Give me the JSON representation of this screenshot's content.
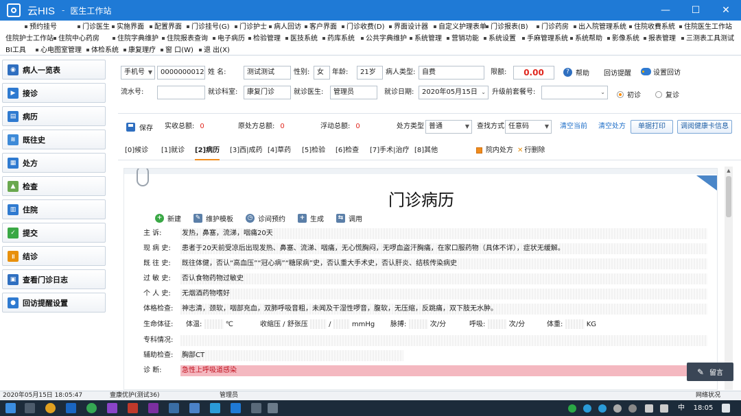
{
  "window": {
    "app_name": "云HIS",
    "subtitle": "医生工作站",
    "controls": [
      "—",
      "☐",
      "✕"
    ]
  },
  "menu": {
    "row1": [
      "预约挂号",
      "门诊医生",
      "实施界面",
      "配置界面",
      "门诊挂号(G)",
      "门诊护士",
      "病人回访",
      "客户界面",
      "门诊收费(D)",
      "界面设计器",
      "自定义护理表单",
      "门诊报表(B)",
      "门诊药房",
      "出入院管理系统",
      "住院收費系統",
      "住院医生工作站"
    ],
    "row2": [
      "住院护士工作站",
      "住院中心药房",
      "住院字典维护",
      "住院报表查询",
      "电子病历",
      "检验管理",
      "医技系统",
      "药库系统",
      "公共字典维护",
      "系统管理",
      "营销功能",
      "系统设置",
      "手麻管理系统",
      "系统帮助",
      "影像系统",
      "报表管理",
      "三测表工具测试"
    ],
    "row3": [
      "BI工具",
      "心电图室管理",
      "体检系统",
      "康复理疗",
      "窗 口(W)",
      "退 出(X)"
    ]
  },
  "sidebar": {
    "items": [
      {
        "label": "病人一览表",
        "icon": "eye-icon",
        "color": "#2f6fc0"
      },
      {
        "label": "接诊",
        "icon": "play-icon",
        "color": "#2f7ad0"
      },
      {
        "label": "病历",
        "icon": "document-icon",
        "color": "#2f7ad0"
      },
      {
        "label": "既往史",
        "icon": "layers-icon",
        "color": "#3d8ad8"
      },
      {
        "label": "处方",
        "icon": "prescription-icon",
        "color": "#2f7ad0"
      },
      {
        "label": "检查",
        "icon": "chart-icon",
        "color": "#6aa84f"
      },
      {
        "label": "住院",
        "icon": "hospital-icon",
        "color": "#2f7ad0"
      },
      {
        "label": "提交",
        "icon": "check-icon",
        "color": "#3aa845"
      },
      {
        "label": "结诊",
        "icon": "pause-icon",
        "color": "#e8900c"
      },
      {
        "label": "查看门诊日志",
        "icon": "calendar-icon",
        "color": "#2f6fc0"
      },
      {
        "label": "回访提醒设置",
        "icon": "chat-icon",
        "color": "#2f7ad0"
      }
    ]
  },
  "patient": {
    "id_type": "手机号",
    "id_value": "0000000012",
    "name_label": "姓 名:",
    "name_value": "测试测试",
    "sex_label": "性别:",
    "sex_value": "女",
    "age_label": "年龄:",
    "age_value": "21岁",
    "type_label": "病人类型:",
    "type_value": "自费",
    "limit_label": "限额:",
    "limit_value": "0.00",
    "help_label": "帮助",
    "revisit_remind_label": "回访提醒",
    "revisit_set_label": "设置回访",
    "serial_label": "流水号:",
    "serial_value": "",
    "dept_label": "就诊科室:",
    "dept_value": "康复门诊",
    "doctor_label": "就诊医生:",
    "doctor_value": "管理员",
    "date_label": "就诊日期:",
    "date_value": "2020年05月15日",
    "prev_label": "升级前套餐号:",
    "prev_value": "",
    "first_visit": "初诊",
    "revisit": "复诊"
  },
  "toolbar": {
    "save": "保存",
    "paid_label": "实收总额:",
    "paid_value": "0",
    "orig_label": "原处方总额:",
    "orig_value": "0",
    "float_label": "浮动总额:",
    "float_value": "0",
    "rx_type_label": "处方类型",
    "rx_type_value": "普通",
    "find_label": "查找方式",
    "find_value": "任意码",
    "clear_current": "清空当前",
    "clear_rx": "清空处方",
    "print_single": "单据打印",
    "health_card": "调阅健康卡信息"
  },
  "tabs": [
    "[0]候诊",
    "[1]就诊",
    "[2]病历",
    "[3]西|成药",
    "[4]草药",
    "[5]检验",
    "[6]检查",
    "[7]手术|治疗",
    "[8]其他"
  ],
  "tab_extras": {
    "in_hospital_rx": "院内处方",
    "delete_row": "行删除"
  },
  "record": {
    "title": "门诊病历",
    "tools": [
      "新建",
      "维护模板",
      "诊间预约",
      "生成",
      "调用"
    ],
    "chief_label": "主 诉:",
    "chief_value": "发热，鼻塞，流涕，咽痛20天",
    "present_label": "现 病 史:",
    "present_value": "患者于20天前受凉后出现发热、鼻塞、流涕、咽痛，无心慌胸闷，无啰血盗汗胸痛，在家口服药物（具体不详），症状无缓解。",
    "past_label": "既 往 史:",
    "past_value": "既往体健，否认“高血压”“冠心病”“糖尿病”史，否认重大手术史，否认肝炎、结核传染病史",
    "allergy_label": "过 敏 史:",
    "allergy_value": "否认食物药物过敏史",
    "personal_label": "个 人 史:",
    "personal_value": "无烟酒药物嗜好",
    "exam_label": "体格检查:",
    "exam_value": "神志清，颈软，咽部充血，双肺呼吸音粗，未闻及干湿性啰音，腹软，无压缩，反跳痛，双下肢无水肿。",
    "vitals_label": "生命体征:",
    "temp_label": "体温:",
    "temp_unit": "℃",
    "bp_label": "收缩压 / 舒张压",
    "bp_sep": "/",
    "bp_unit": "mmHg",
    "pulse_label": "脉搏:",
    "pulse_unit": "次/分",
    "resp_label": "呼吸:",
    "resp_unit": "次/分",
    "weight_label": "体重:",
    "weight_unit": "KG",
    "special_label": "专科情况:",
    "special_value": "",
    "aux_label": "辅助检查:",
    "aux_value": "胸部CT",
    "diag_label": "诊 断:",
    "diag_value": "急性上呼吸道感染"
  },
  "message_button": "留言",
  "status": {
    "datetime": "2020年05月15日 18:05:47",
    "org": "壹康优护(测试36)",
    "user": "管理员",
    "network": "网络状况"
  },
  "taskbar": {
    "time": "18:05",
    "ime": "中"
  }
}
